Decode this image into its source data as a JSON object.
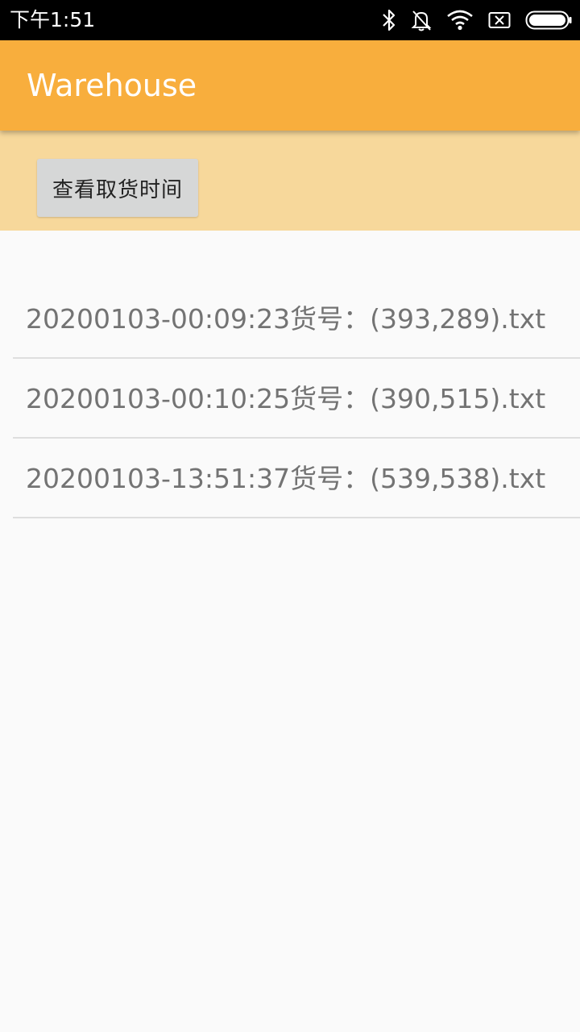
{
  "status_bar": {
    "time": "下午1:51",
    "icons": [
      "bluetooth-icon",
      "notifications-off-icon",
      "wifi-icon",
      "sim-none-icon",
      "battery-icon"
    ]
  },
  "app_bar": {
    "title": "Warehouse"
  },
  "actions": {
    "view_pickup_time_label": "查看取货时间"
  },
  "files": [
    {
      "name": "20200103-00:09:23货号：(393,289).txt"
    },
    {
      "name": "20200103-00:10:25货号：(390,515).txt"
    },
    {
      "name": "20200103-13:51:37货号：(539,538).txt"
    }
  ],
  "colors": {
    "app_bar": "#f8ae3d",
    "action_area": "#f7d89b",
    "button": "#d6d7d7",
    "list_text": "#737373",
    "background": "#fafafa"
  }
}
